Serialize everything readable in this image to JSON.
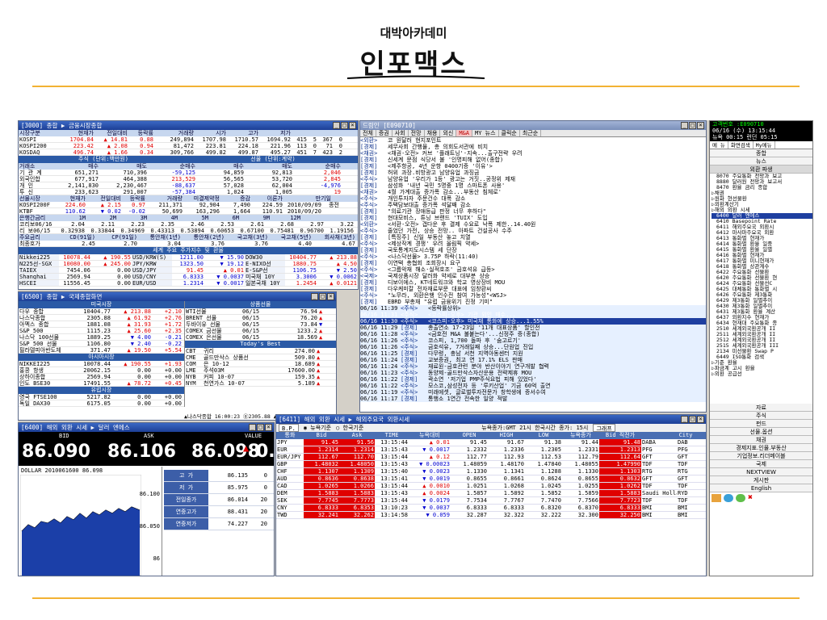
{
  "slide": {
    "subtitle": "대박아카데미",
    "title": "인포맥스"
  },
  "w3000": {
    "title": "[3000] 종합 ▶ 금융시장종합",
    "stocks_head": [
      "시장구분",
      "현재가",
      "전일대비",
      "등락률",
      "거래량",
      "시가",
      "고가",
      "저가"
    ],
    "stocks": [
      [
        "KOSPI",
        "1704.84",
        "▲",
        "14.81",
        "0.88",
        "249,894",
        "1707.98",
        "1710.57",
        "1694.92",
        "415",
        "5",
        "367",
        "0"
      ],
      [
        "KOSPI200",
        "223.42",
        "▲",
        "2.08",
        "0.94",
        "81,472",
        "223.81",
        "224.18",
        "221.96",
        "113",
        "0",
        "71",
        "0"
      ],
      [
        "KOSDAQ",
        "496.74",
        "▲",
        "1.66",
        "0.34",
        "309,766",
        "499.82",
        "499.87",
        "495.27",
        "451",
        "7",
        "423",
        "2"
      ]
    ],
    "inv_sec_a": "주식 (단위:백만원)",
    "inv_sec_b": "선물 (단위:계약)",
    "inv_head": [
      "거래소",
      "매수",
      "매도",
      "순매수",
      "매수",
      "매도",
      "순매수"
    ],
    "inv": [
      [
        "기 관 계",
        "651,271",
        "710,396",
        "-59,125",
        "94,859",
        "92,813",
        "2,046"
      ],
      [
        "외국인합",
        "677,917",
        "464,388",
        "213,529",
        "56,565",
        "53,720",
        "2,845"
      ],
      [
        "개 인",
        "2,141,830",
        "2,230,467",
        "-88,637",
        "57,028",
        "62,004",
        "-4,976"
      ],
      [
        "투 신",
        "233,623",
        "291,007",
        "-57,384",
        "1,024",
        "1,005",
        "19"
      ]
    ],
    "fut_head": [
      "선물시장",
      "현재가",
      "전일대비",
      "등락률",
      "거래량",
      "미결제약정",
      "증감",
      "이론가",
      "만기일"
    ],
    "fut": [
      [
        "KOSPI200F",
        "224.60",
        "▲",
        "2.15",
        "0.97",
        "211,371",
        "92,904",
        "7,490",
        "224.59",
        "2010/09/09",
        "종전"
      ],
      [
        "KTBF",
        "110.62",
        "▼",
        "0.02",
        "-0.02",
        "50,699",
        "163,296",
        "1,664",
        "110.91",
        "2010/09/20",
        ""
      ]
    ],
    "rate_head": [
      "은행간금리",
      "1M",
      "2M",
      "3M",
      "4M",
      "5M",
      "6M",
      "9M",
      "12M"
    ],
    "rates": [
      [
        "코리보06/16",
        "2.04",
        "2.11",
        "2.23",
        "2.35",
        "2.46",
        "2.53",
        "2.61",
        "2.68",
        "2.97",
        "3.22"
      ],
      [
        "리 보06/15",
        "0.32938",
        "0.33844",
        "0.34969",
        "0.43313",
        "0.53894",
        "0.60653",
        "0.67100",
        "0.75481",
        "0.96700",
        "1.19156"
      ]
    ],
    "main_head": [
      "주요금리",
      "CD(91일)",
      "CP(91일)",
      "통안채(1년)",
      "통안채(2년)",
      "국고채(3년)",
      "국고채(5년)",
      "회사채(3년)"
    ],
    "main_rate": [
      "최종호가",
      "2.45",
      "2.70",
      "3.04",
      "3.76",
      "3.76",
      "4.40",
      "4.67"
    ],
    "world_sec": "세계 주요 주가지수 및 환율",
    "world": [
      [
        "Nikkei225",
        "10078.44",
        "▲",
        "190.55",
        "USD/KRW(S)",
        "1211.00",
        "▼",
        "15.90",
        "DOW30",
        "10404.77",
        "▲",
        "213.88"
      ],
      [
        "N225선-SGX",
        "10080.00",
        "▲",
        "245.00",
        "JPY/KRW",
        "1323.50",
        "▼",
        "19.12",
        "E-NIXO선",
        "1880.75",
        "▲",
        "4.50"
      ],
      [
        "TAIEX",
        "7454.06",
        "",
        "0.00",
        "USD/JPY",
        "91.45",
        "▲",
        "0.01",
        "E-S&P선",
        "1106.75",
        "▼",
        "2.50"
      ],
      [
        "Shanghai",
        "2569.94",
        "",
        "0.00",
        "USD/CNY",
        "6.8333",
        "▼",
        "0.0037",
        "미국채 10Y",
        "3.3006",
        "▼",
        "0.0062"
      ],
      [
        "HSCEI",
        "11556.45",
        "",
        "0.00",
        "EUR/USD",
        "1.2314",
        "▼",
        "0.0017",
        "일본국채 10Y",
        "1.2454",
        "▲",
        "0.0121"
      ]
    ]
  },
  "w6500": {
    "title": "[6500] 종합 ▶ 국제종합화면",
    "sec_us": "미국시장",
    "us": [
      [
        "다우 종합",
        "10404.77",
        "▲",
        "213.88",
        "+2.10"
      ],
      [
        "나스닥종합",
        "2305.88",
        "▲",
        "61.92",
        "+2.76"
      ],
      [
        "아멕스 종합",
        "1881.08",
        "▲",
        "31.93",
        "+1.72"
      ],
      [
        "S&P 500",
        "1115.23",
        "▲",
        "25.60",
        "+2.35"
      ],
      [
        "나스닥 100선물",
        "1889.25",
        "▼",
        "4.00",
        "-0.21"
      ],
      [
        "S&P 500 선물",
        "1106.80",
        "▼",
        "2.40",
        "-0.22"
      ],
      [
        "필라델피아반도체",
        "371.47",
        "▲",
        "19.50",
        "+5.54"
      ]
    ],
    "sec_asia": "아시아시장",
    "asia": [
      [
        "NIKKEI225",
        "10078.44",
        "▲",
        "190.55",
        "+1.93"
      ],
      [
        "홍콩 항생",
        "20062.15",
        "",
        "0.00",
        "+0.00"
      ],
      [
        "상하이종합",
        "2569.94",
        "",
        "0.00",
        "+0.00"
      ],
      [
        "인도 BSE30",
        "17491.55",
        "▲",
        "78.72",
        "+0.45"
      ]
    ],
    "sec_eu": "유럽시장",
    "eu": [
      [
        "영국 FTSE100",
        "5217.82",
        "",
        "0.00",
        "+0.00"
      ],
      [
        "독일 DAX30",
        "6175.05",
        "",
        "0.00",
        "+0.00"
      ]
    ],
    "sec_com": "상품선물",
    "com": [
      [
        "WTI선물",
        "06/15",
        "76.94",
        "▲"
      ],
      [
        "BRENT 선물",
        "06/15",
        "76.20",
        "▲"
      ],
      [
        "두바이유 선물",
        "06/15",
        "73.84",
        "▼"
      ],
      [
        "COMEX 금선물",
        "06/15",
        "1233.2",
        "▲"
      ],
      [
        "COMEX 은선물",
        "06/15",
        "18.569",
        "▲"
      ]
    ],
    "sec_best": "Today's Best",
    "best": [
      [
        "CBT",
        "귀리",
        "274.00",
        "▲"
      ],
      [
        "CME",
        "골드만삭스 상품선",
        "509.80",
        "▲"
      ],
      [
        "COM",
        "은 10-12",
        "18.689",
        "▲"
      ],
      [
        "LME",
        "주석03M",
        "17600.00",
        "▲"
      ],
      [
        "NYB",
        "커피 10-07",
        "159.35",
        "▲"
      ],
      [
        "NYM",
        "천연가스 10-07",
        "5.189",
        "▲"
      ]
    ],
    "footer": "▲나스닥종합 16:00:23 ⑧2305.88 ▲ 61.92 (+2.76 %)"
  },
  "w6400": {
    "title": "[6400] 해외 외환 시세 ▶ 달러 엔에스",
    "bid_label": "BID",
    "ask_label": "ASK",
    "value_label": "VALUE",
    "bid": "86.090",
    "ask": "86.106",
    "value": "86.098",
    "change": "0.",
    "chart_label": "DOLLAR  2010061600  86.098",
    "chart_ticks": [
      "86.100",
      "86.050",
      "86"
    ],
    "stats": [
      [
        "고",
        "가",
        "86.135",
        "0"
      ],
      [
        "저",
        "가",
        "85.975",
        "0"
      ],
      [
        "전일종가",
        "",
        "86.014",
        "20"
      ],
      [
        "연중고가",
        "",
        "88.431",
        "20"
      ],
      [
        "연중저가",
        "",
        "74.227",
        "20"
      ]
    ]
  },
  "news": {
    "title": "드림인 [E090710]",
    "tabs": [
      "전체",
      "증권",
      "사회",
      "전망",
      "채용",
      "외신",
      "M&A",
      "MY 뉴스",
      "클릭순",
      "최근순"
    ],
    "items": [
      [
        "<외환>",
        "코 원달러 현지포인트"
      ],
      [
        "[경제]",
        "세무사회 간행물, 총 의회도서관에 비치"
      ],
      [
        "<채권>",
        "<채권-오전> 커브 '플래트닝'·지속...출구전략 우려"
      ],
      [
        "[경제]",
        "신세계 문점 식당서 불 '인명피해 없어(종합)"
      ],
      [
        "[경제]",
        "<제주항공, 4년 운항 0400기증 '이유'>"
      ],
      [
        "[경제]",
        "허위 과장.비방광고 남양유업 과징금"
      ],
      [
        "<주식>",
        "남양유업 '우리가 1등' 광고는 거짓..공정위 제재"
      ],
      [
        "[경제]",
        "삼성화 '내년 국민 5명중 1명 스마트폰 사용'"
      ],
      [
        "<채권>",
        "4월 가계대출 증가폭 감소...부동산 침체로'"
      ],
      [
        "<주식>",
        "개인투자자 주문건수 대폭 감소"
      ],
      [
        "<주식>",
        "주택담보대출 증가폭 석달째 감소"
      ],
      [
        "[경제]",
        "\"의료기관 장애등급 판정 너무 후하다\""
      ],
      [
        "[경제]",
        "현대모비스, 튜닝 브랜드 'TUIX' 도입"
      ],
      [
        "<외환>",
        "<서환-오전> 갭다운 후 결제 수요로 낙폭 제한..14.40원"
      ],
      [
        "<주식>",
        "줄었던 가전, 상승 전망.. 아파트 건설공사 수주"
      ],
      [
        "[경제]",
        "[특징주] 신일 부동산 놓고 치열"
      ],
      [
        "<주식>",
        "<제상작계 경쟁' 우려 올림픽 약세>"
      ],
      [
        "[경제]",
        "국토통계지도시스템 세 단장"
      ],
      [
        "<주식>",
        "<나스닥선물> 3.75P 하락(11:40)"
      ],
      [
        "[경제]",
        "이연택 총협회 조회장시 요구"
      ],
      [
        "<주식>",
        "<그룹악재 해소·실적호조' 금호석유 급등>"
      ],
      [
        "<국제>",
        "국제상품시장 달러화 약세로 대부분 상승"
      ],
      [
        "[경제]",
        "디보이에스, KT네트워크와 학교 영상장비 MOU"
      ],
      [
        "[경제]",
        "다우케미칼 전자재료부문 대표에 임창환씨"
      ],
      [
        "<주식>",
        "\"노무라, 외환은행 인수전 참여 가능성\"<WSJ>"
      ],
      [
        "[경제]",
        "EBRD 부총재 \"유럽 금융위기 진정 기미\""
      ],
      [
        "<주식>",
        "<등락률상위>"
      ],
      [
        "<주식>",
        "<코스피-오후> 기관 외인 매수..."
      ],
      [
        "<주식>",
        "<코스피-오후> 미국채 통화에 상승...1.55%"
      ],
      [
        "[경제]",
        "총출연소 17-23일 '11개 대표상품' 할인전"
      ],
      [
        "<주식>",
        "<금호전 M&A 불붙는다'...신정주 증(종합)"
      ],
      [
        "<주식>",
        "코스피, 1,700 돌파 후 '숨고르기'"
      ],
      [
        "<주식>",
        "금호석유, 7거래일째 상승...단원업 진입"
      ],
      [
        "[경제]",
        "다무령, 충남 서천 지역아동센터 지원"
      ],
      [
        "[경제]",
        "교보증권, 최고 연 17.1% ELS 판매"
      ],
      [
        "<주식>",
        "재료원-금호관련 분야 반산이야기 연구개발 협력"
      ],
      [
        "<주식>",
        "동양제-골드만삭스자산운용 전략제휴 MOU"
      ],
      [
        "[경제]",
        "곽소연 '저기업 PMP주식요법 피해 있었다'"
      ],
      [
        "<주식>",
        "모스코,삼성전자 등 '루키산업' 기금 60억 출연"
      ],
      [
        "<주식>",
        "미래에셋, 글로벌투자전문가 창학생에 증서수여"
      ],
      [
        "[경제]",
        "통행소 1연간 전속한 일양 적발"
      ]
    ],
    "times": [
      "06/16 11:39",
      "06/16 11:31",
      "06/16 11:30",
      "06/16 11:29",
      "06/16 11:28",
      "06/16 11:26",
      "06/16 11:26",
      "06/16 11:25",
      "06/16 11:24",
      "06/16 11:24",
      "06/16 11:23",
      "06/16 11:22",
      "06/16 11:22",
      "06/16 11:19",
      "06/16 11:17"
    ]
  },
  "w6411": {
    "title": "[6411] 해외 외환 시세 ▶ 해외주요국 외환시세",
    "bp": "B.P.",
    "radio1": "뉴욕기준",
    "radio2": "한국기준",
    "time_note": "뉴욕종가:GMT 21시   한국시간 종가: 15시",
    "btn": "그래프",
    "head": [
      "통화",
      "Bid",
      "Ask",
      "TIME",
      "뉴욕대비",
      "OPEN",
      "HIGH",
      "LOW",
      "뉴욕종가",
      "Bid 직전가",
      "City"
    ],
    "rows": [
      [
        "JPY",
        "91.45",
        "91.56",
        "13:15:44",
        "▲",
        "0.01",
        "91.45",
        "91.67",
        "91.38",
        "91.44",
        "91.48",
        "DABA",
        "DAB"
      ],
      [
        "EUR",
        "1.2314",
        "1.2314",
        "13:15:43",
        "▼",
        "0.0017",
        "1.2332",
        "1.2336",
        "1.2305",
        "1.2331",
        "1.2313",
        "PFG",
        "PFG"
      ],
      [
        "EUR/JPY",
        "112.67",
        "112.70",
        "13:15:44",
        "▲",
        "0.12",
        "112.77",
        "112.93",
        "112.53",
        "112.79",
        "112.64",
        "GFT",
        "GFT"
      ],
      [
        "GBP",
        "1.48032",
        "1.48050",
        "13:15:43",
        "▼",
        "0.00023",
        "1.48059",
        "1.48170",
        "1.47840",
        "1.48055",
        "1.47990",
        "TDF",
        "TDF"
      ],
      [
        "CHF",
        "1.1307",
        "1.1309",
        "13:15:40",
        "▼",
        "0.0023",
        "1.1330",
        "1.1341",
        "1.1288",
        "1.1330",
        "1.1303",
        "RTG",
        "RTG"
      ],
      [
        "AUD",
        "0.8636",
        "0.8638",
        "13:15:41",
        "▼",
        "0.0019",
        "0.8655",
        "0.8661",
        "0.8624",
        "0.8655",
        "0.8632",
        "GFT",
        "GFT"
      ],
      [
        "CAD",
        "1.0265",
        "1.0266",
        "13:15:44",
        "▲",
        "0.0010",
        "1.0251",
        "1.0268",
        "1.0245",
        "1.0255",
        "1.0262",
        "TDF",
        "TDF"
      ],
      [
        "DEM",
        "1.5883",
        "1.5883",
        "13:15:43",
        "▲",
        "0.0024",
        "1.5857",
        "1.5892",
        "1.5852",
        "1.5859",
        "1.5883",
        "Saudi Hollan",
        "RYD"
      ],
      [
        "SEK",
        "7.7745",
        "7.7773",
        "13:15:44",
        "▼",
        "0.0179",
        "7.7534",
        "7.7767",
        "7.7470",
        "7.7566",
        "7.7723",
        "TDF",
        "TDF"
      ],
      [
        "CNY",
        "6.8333",
        "6.8353",
        "13:10:23",
        "▼",
        "0.0037",
        "6.8333",
        "6.8333",
        "6.8320",
        "6.8370",
        "6.8333",
        "BMI",
        "BMI"
      ],
      [
        "TWD",
        "32.241",
        "32.262",
        "13:14:58",
        "▼",
        "0.059",
        "32.287",
        "32.322",
        "32.222",
        "32.300",
        "32.250",
        "BMI",
        "BMI"
      ]
    ]
  },
  "sidebar": {
    "acct": "고객번호 :E090710",
    "datetime": "06/16 (수) 13:15:44",
    "news_time": "뉴욕 00:15  런던 05:15",
    "tabs": [
      "메 뉴",
      "화면검색",
      "My메뉴"
    ],
    "top_items": [
      "종합",
      "뉴스",
      "외환 파생"
    ],
    "tree": [
      "8070 주요통화 전망과 보고",
      "8880 달러원 전망과 보고서",
      "8470 환율 금리 종합",
      "▷채권",
      "▷원화 현선물환",
      "▷외환계산기",
      "▷해외 외환 시세",
      "6400 달러 엔에스",
      "6410 Basepoint Rate",
      "6411 해외주요국 외환시",
      "6412 마샤마주요국 외환",
      "6413 통화별 현재가",
      "6414 통화별 환율 일중",
      "6415 통화별 환율 일별",
      "6416 통화별 현재가",
      "6417 통화별 미니현재가",
      "6418 통화별 상관계수",
      "6422 주요통화 선물환",
      "6420 주요통화 선물환 현",
      "6424 주요통화 선물선C",
      "6425 대체통화 통화별 시",
      "6426 주요통화 제3통화",
      "6429 제3통화 일별추이",
      "6430 제3통화 일별추이",
      "6431 제3통화 환율 계산",
      "6437 외환지수 현재가",
      "6434 현재대 주요통화 종",
      "2510 세계외국환공개 II",
      "2511 세계외국환공개 II",
      "2512 세계외국환공개 II",
      "2515 세계외국환공개 III",
      "2134 미선물환 Swap P",
      "6449 ISO통화 검색",
      "▷기준 환율",
      "▷파금계 고시 환율",
      "▷외환 공급선"
    ],
    "bottom_items": [
      "자료",
      "주식",
      "펀드",
      "선물.옵션",
      "채권",
      "경제지표.인물.부동산",
      "기업정보.리더메이블",
      "국제",
      "NEXTVIEW",
      "게시판",
      "English"
    ]
  }
}
